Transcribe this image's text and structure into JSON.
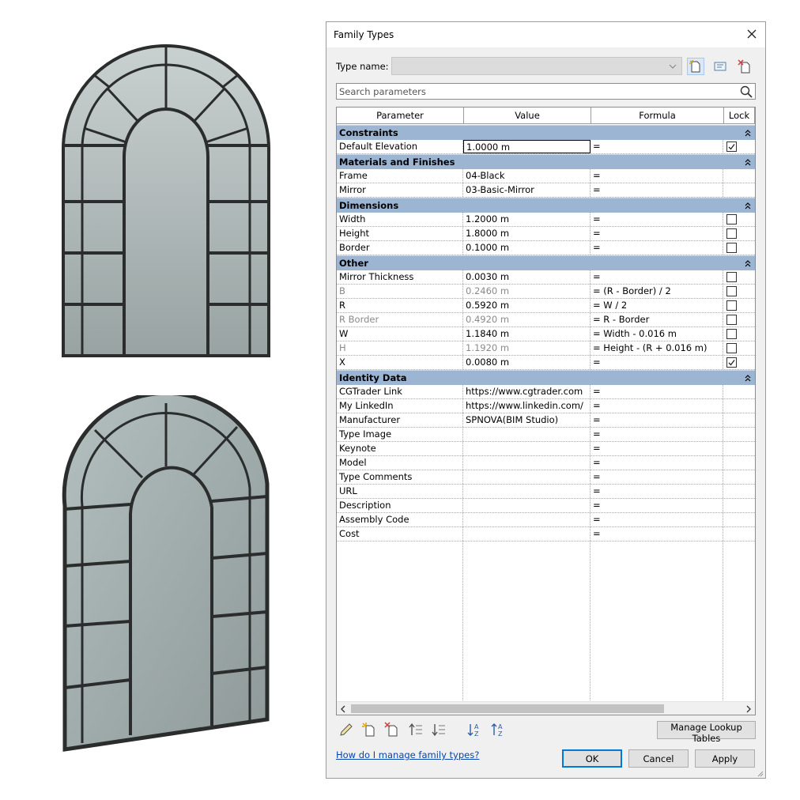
{
  "dialog": {
    "title": "Family Types",
    "type_name_label": "Type name:",
    "type_name_value": "",
    "search_placeholder": "Search parameters",
    "columns": [
      "Parameter",
      "Value",
      "Formula",
      "Lock"
    ],
    "groups": [
      {
        "name": "Constraints",
        "rows": [
          {
            "parameter": "Default Elevation",
            "value": "1.0000 m",
            "formula": "=",
            "lock": true,
            "has_lock": true,
            "dim": false,
            "active": true
          }
        ]
      },
      {
        "name": "Materials and Finishes",
        "rows": [
          {
            "parameter": "Frame",
            "value": "04-Black",
            "formula": "=",
            "has_lock": false,
            "lock": false,
            "dim": false
          },
          {
            "parameter": "Mirror",
            "value": "03-Basic-Mirror",
            "formula": "=",
            "has_lock": false,
            "lock": false,
            "dim": false
          }
        ]
      },
      {
        "name": "Dimensions",
        "rows": [
          {
            "parameter": "Width",
            "value": "1.2000 m",
            "formula": "=",
            "has_lock": true,
            "lock": false,
            "dim": false
          },
          {
            "parameter": "Height",
            "value": "1.8000 m",
            "formula": "=",
            "has_lock": true,
            "lock": false,
            "dim": false
          },
          {
            "parameter": "Border",
            "value": "0.1000 m",
            "formula": "=",
            "has_lock": true,
            "lock": false,
            "dim": false
          }
        ]
      },
      {
        "name": "Other",
        "rows": [
          {
            "parameter": "Mirror Thickness",
            "value": "0.0030 m",
            "formula": "=",
            "has_lock": true,
            "lock": false,
            "dim": false
          },
          {
            "parameter": "B",
            "value": "0.2460 m",
            "formula": "= (R - Border) / 2",
            "has_lock": true,
            "lock": false,
            "dim": true
          },
          {
            "parameter": "R",
            "value": "0.5920 m",
            "formula": "= W / 2",
            "has_lock": true,
            "lock": false,
            "dim": false
          },
          {
            "parameter": "R Border",
            "value": "0.4920 m",
            "formula": "= R - Border",
            "has_lock": true,
            "lock": false,
            "dim": true
          },
          {
            "parameter": "W",
            "value": "1.1840 m",
            "formula": "= Width - 0.016 m",
            "has_lock": true,
            "lock": false,
            "dim": false
          },
          {
            "parameter": "H",
            "value": "1.1920 m",
            "formula": "= Height - (R + 0.016 m)",
            "has_lock": true,
            "lock": false,
            "dim": true
          },
          {
            "parameter": "X",
            "value": "0.0080 m",
            "formula": "=",
            "has_lock": true,
            "lock": true,
            "dim": false
          }
        ]
      },
      {
        "name": "Identity Data",
        "rows": [
          {
            "parameter": "CGTrader Link",
            "value": "https://www.cgtrader.com",
            "formula": "=",
            "has_lock": false,
            "lock": false,
            "dim": false
          },
          {
            "parameter": "My LinkedIn",
            "value": "https://www.linkedin.com/",
            "formula": "=",
            "has_lock": false,
            "lock": false,
            "dim": false
          },
          {
            "parameter": "Manufacturer",
            "value": "SPNOVA(BIM Studio)",
            "formula": "=",
            "has_lock": false,
            "lock": false,
            "dim": false
          },
          {
            "parameter": "Type Image",
            "value": "",
            "formula": "=",
            "has_lock": false,
            "lock": false,
            "dim": false
          },
          {
            "parameter": "Keynote",
            "value": "",
            "formula": "=",
            "has_lock": false,
            "lock": false,
            "dim": false
          },
          {
            "parameter": "Model",
            "value": "",
            "formula": "=",
            "has_lock": false,
            "lock": false,
            "dim": false
          },
          {
            "parameter": "Type Comments",
            "value": "",
            "formula": "=",
            "has_lock": false,
            "lock": false,
            "dim": false
          },
          {
            "parameter": "URL",
            "value": "",
            "formula": "=",
            "has_lock": false,
            "lock": false,
            "dim": false
          },
          {
            "parameter": "Description",
            "value": "",
            "formula": "=",
            "has_lock": false,
            "lock": false,
            "dim": false
          },
          {
            "parameter": "Assembly Code",
            "value": "",
            "formula": "=",
            "has_lock": false,
            "lock": false,
            "dim": false
          },
          {
            "parameter": "Cost",
            "value": "",
            "formula": "=",
            "has_lock": false,
            "lock": false,
            "dim": false
          }
        ]
      }
    ],
    "manage_lookup_label": "Manage Lookup Tables",
    "help_link": "How do I manage family types?",
    "buttons": {
      "ok": "OK",
      "cancel": "Cancel",
      "apply": "Apply"
    }
  },
  "icons": {
    "close": "close-icon",
    "dropdown": "chevron-down-icon",
    "new_type": "new-type-icon",
    "rename_type": "rename-type-icon",
    "delete_type": "delete-type-icon",
    "search": "search-icon",
    "collapse": "collapse-icon",
    "edit": "pencil-icon",
    "new_parameter": "new-parameter-icon",
    "delete_parameter": "delete-parameter-icon",
    "move_up": "move-up-icon",
    "move_down": "move-down-icon",
    "sort_ascending": "sort-ascending-icon",
    "sort_descending": "sort-descending-icon"
  },
  "colors": {
    "group_header": "#9bb5d3",
    "dialog_bg": "#f0f0f0",
    "ok_border": "#0078d7",
    "link": "#0645ad",
    "frame": "#2b2d2d",
    "glass": "#a9b3b2"
  }
}
